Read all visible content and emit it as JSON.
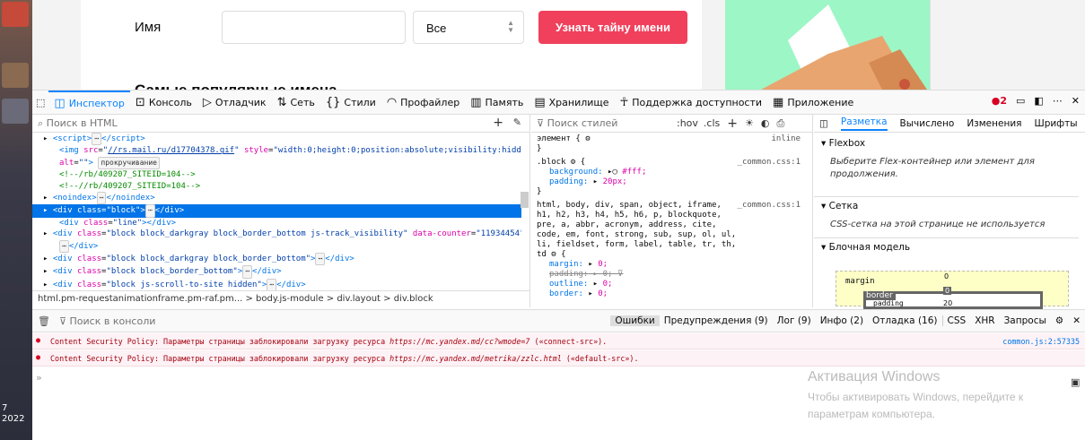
{
  "site": {
    "name_label": "Имя",
    "select_value": "Все",
    "button_label": "Узнать тайну имени",
    "popular_heading": "Самые популярные имена"
  },
  "devtools": {
    "tabs": [
      {
        "label": "Инспектор",
        "icon": "inspector-icon",
        "active": true
      },
      {
        "label": "Консоль",
        "icon": "console-icon"
      },
      {
        "label": "Отладчик",
        "icon": "debugger-icon"
      },
      {
        "label": "Сеть",
        "icon": "network-icon"
      },
      {
        "label": "Стили",
        "icon": "style-editor-icon"
      },
      {
        "label": "Профайлер",
        "icon": "profiler-icon"
      },
      {
        "label": "Память",
        "icon": "memory-icon"
      },
      {
        "label": "Хранилище",
        "icon": "storage-icon"
      },
      {
        "label": "Поддержка доступности",
        "icon": "accessibility-icon"
      },
      {
        "label": "Приложение",
        "icon": "application-icon"
      }
    ],
    "error_count": "2",
    "search_html_placeholder": "Поиск в HTML",
    "breadcrumbs": "html.pm-requestanimationframe.pm-raf.pm... > body.js-module > div.layout > div.block",
    "rules": {
      "filter_placeholder": "Поиск стилей",
      "hov": ":hov",
      "cls": ".cls",
      "element_rule": "элемент {",
      "inline": "inline",
      "block_selector": ".block",
      "block_source": "_common.css:1",
      "background": "background:",
      "background_val": "#fff;",
      "padding": "padding:",
      "padding_val": "20px;",
      "reset_selector": "html, body, div, span, object, iframe, h1, h2, h3, h4, h5, h6, p, blockquote, pre, a, abbr, acronym, address, cite, code, em, font, strong, sub, sup, ol, ul, li, fieldset, form, label, table, tr, th, td",
      "reset_source": "_common.css:1",
      "margin": "margin:",
      "margin_val": "0;",
      "padding2_val": "0;",
      "outline": "outline:",
      "outline_val": "0;",
      "border": "border:",
      "border_val": "0;"
    },
    "layout": {
      "tabs": [
        "Разметка",
        "Вычислено",
        "Изменения",
        "Шрифты"
      ],
      "flexbox_title": "Flexbox",
      "flexbox_note": "Выберите Flex-контейнер или элемент для продолжения.",
      "grid_title": "Сетка",
      "grid_note": "CSS-сетка на этой странице не используется",
      "boxmodel_title": "Блочная модель",
      "margin_label": "margin",
      "margin_val": "0",
      "border_label": "border",
      "border_val": "0",
      "padding_label": "padding",
      "padding_val": "20"
    },
    "console": {
      "filter_placeholder": "Поиск в консоли",
      "filters": [
        "Ошибки",
        "Предупреждения (9)",
        "Лог (9)",
        "Инфо (2)",
        "Отладка (16)"
      ],
      "net_filters": [
        "CSS",
        "XHR",
        "Запросы"
      ],
      "messages": [
        {
          "text": "Content Security Policy: Параметры страницы заблокировали загрузку ресурса ",
          "url": "https://mc.yandex.md/cc?wmode=7",
          "suffix": " («connect-src»).",
          "source": "common.js:2:57335"
        },
        {
          "text": "Content Security Policy: Параметры страницы заблокировали загрузку ресурса ",
          "url": "https://mc.yandex.md/metrika/zzlc.html",
          "suffix": " («default-src»).",
          "source": ""
        }
      ]
    }
  },
  "watermark": {
    "line1": "Активация Windows",
    "line2": "Чтобы активировать Windows, перейдите к",
    "line3": "параметрам компьютера."
  },
  "clock": {
    "time": "7",
    "year": "2022"
  },
  "colors": {
    "accent": "#0a84ff",
    "button": "#f0405c",
    "error": "#d70022",
    "selected_row": "#0074e8"
  }
}
